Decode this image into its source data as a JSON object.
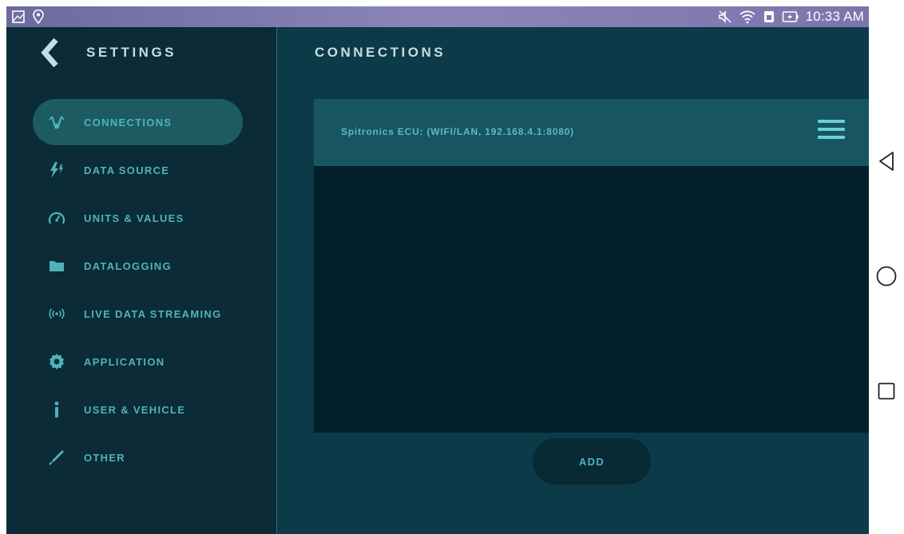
{
  "status_bar": {
    "time": "10:33 AM",
    "left_icons": [
      "gallery-icon",
      "location-icon"
    ],
    "right_icons": [
      "mute-icon",
      "wifi-icon",
      "sim-icon",
      "battery-charging-icon"
    ],
    "color": "#7a76ac"
  },
  "sidebar": {
    "title": "SETTINGS",
    "items": [
      {
        "label": "CONNECTIONS",
        "icon": "antenna-icon"
      },
      {
        "label": "DATA SOURCE",
        "icon": "lightning-icon"
      },
      {
        "label": "UNITS & VALUES",
        "icon": "gauge-icon"
      },
      {
        "label": "DATALOGGING",
        "icon": "folder-icon"
      },
      {
        "label": "LIVE DATA STREAMING",
        "icon": "broadcast-icon"
      },
      {
        "label": "APPLICATION",
        "icon": "gear-icon"
      },
      {
        "label": "USER & VEHICLE",
        "icon": "info-icon"
      },
      {
        "label": "OTHER",
        "icon": "pen-icon"
      }
    ],
    "active_index": 0
  },
  "main": {
    "title": "CONNECTIONS",
    "connections": [
      {
        "label": "Spitronics ECU: (WIFI/LAN, 192.168.4.1:8080)"
      }
    ],
    "add_label": "ADD"
  },
  "nav_bar": {
    "icons": [
      "back-triangle-icon",
      "home-circle-icon",
      "recents-square-icon"
    ]
  },
  "colors": {
    "accent": "#4fb3bd",
    "sidebar_bg": "#0b2b36",
    "main_bg": "#0d3a48",
    "active_item": "#1d5b63"
  }
}
